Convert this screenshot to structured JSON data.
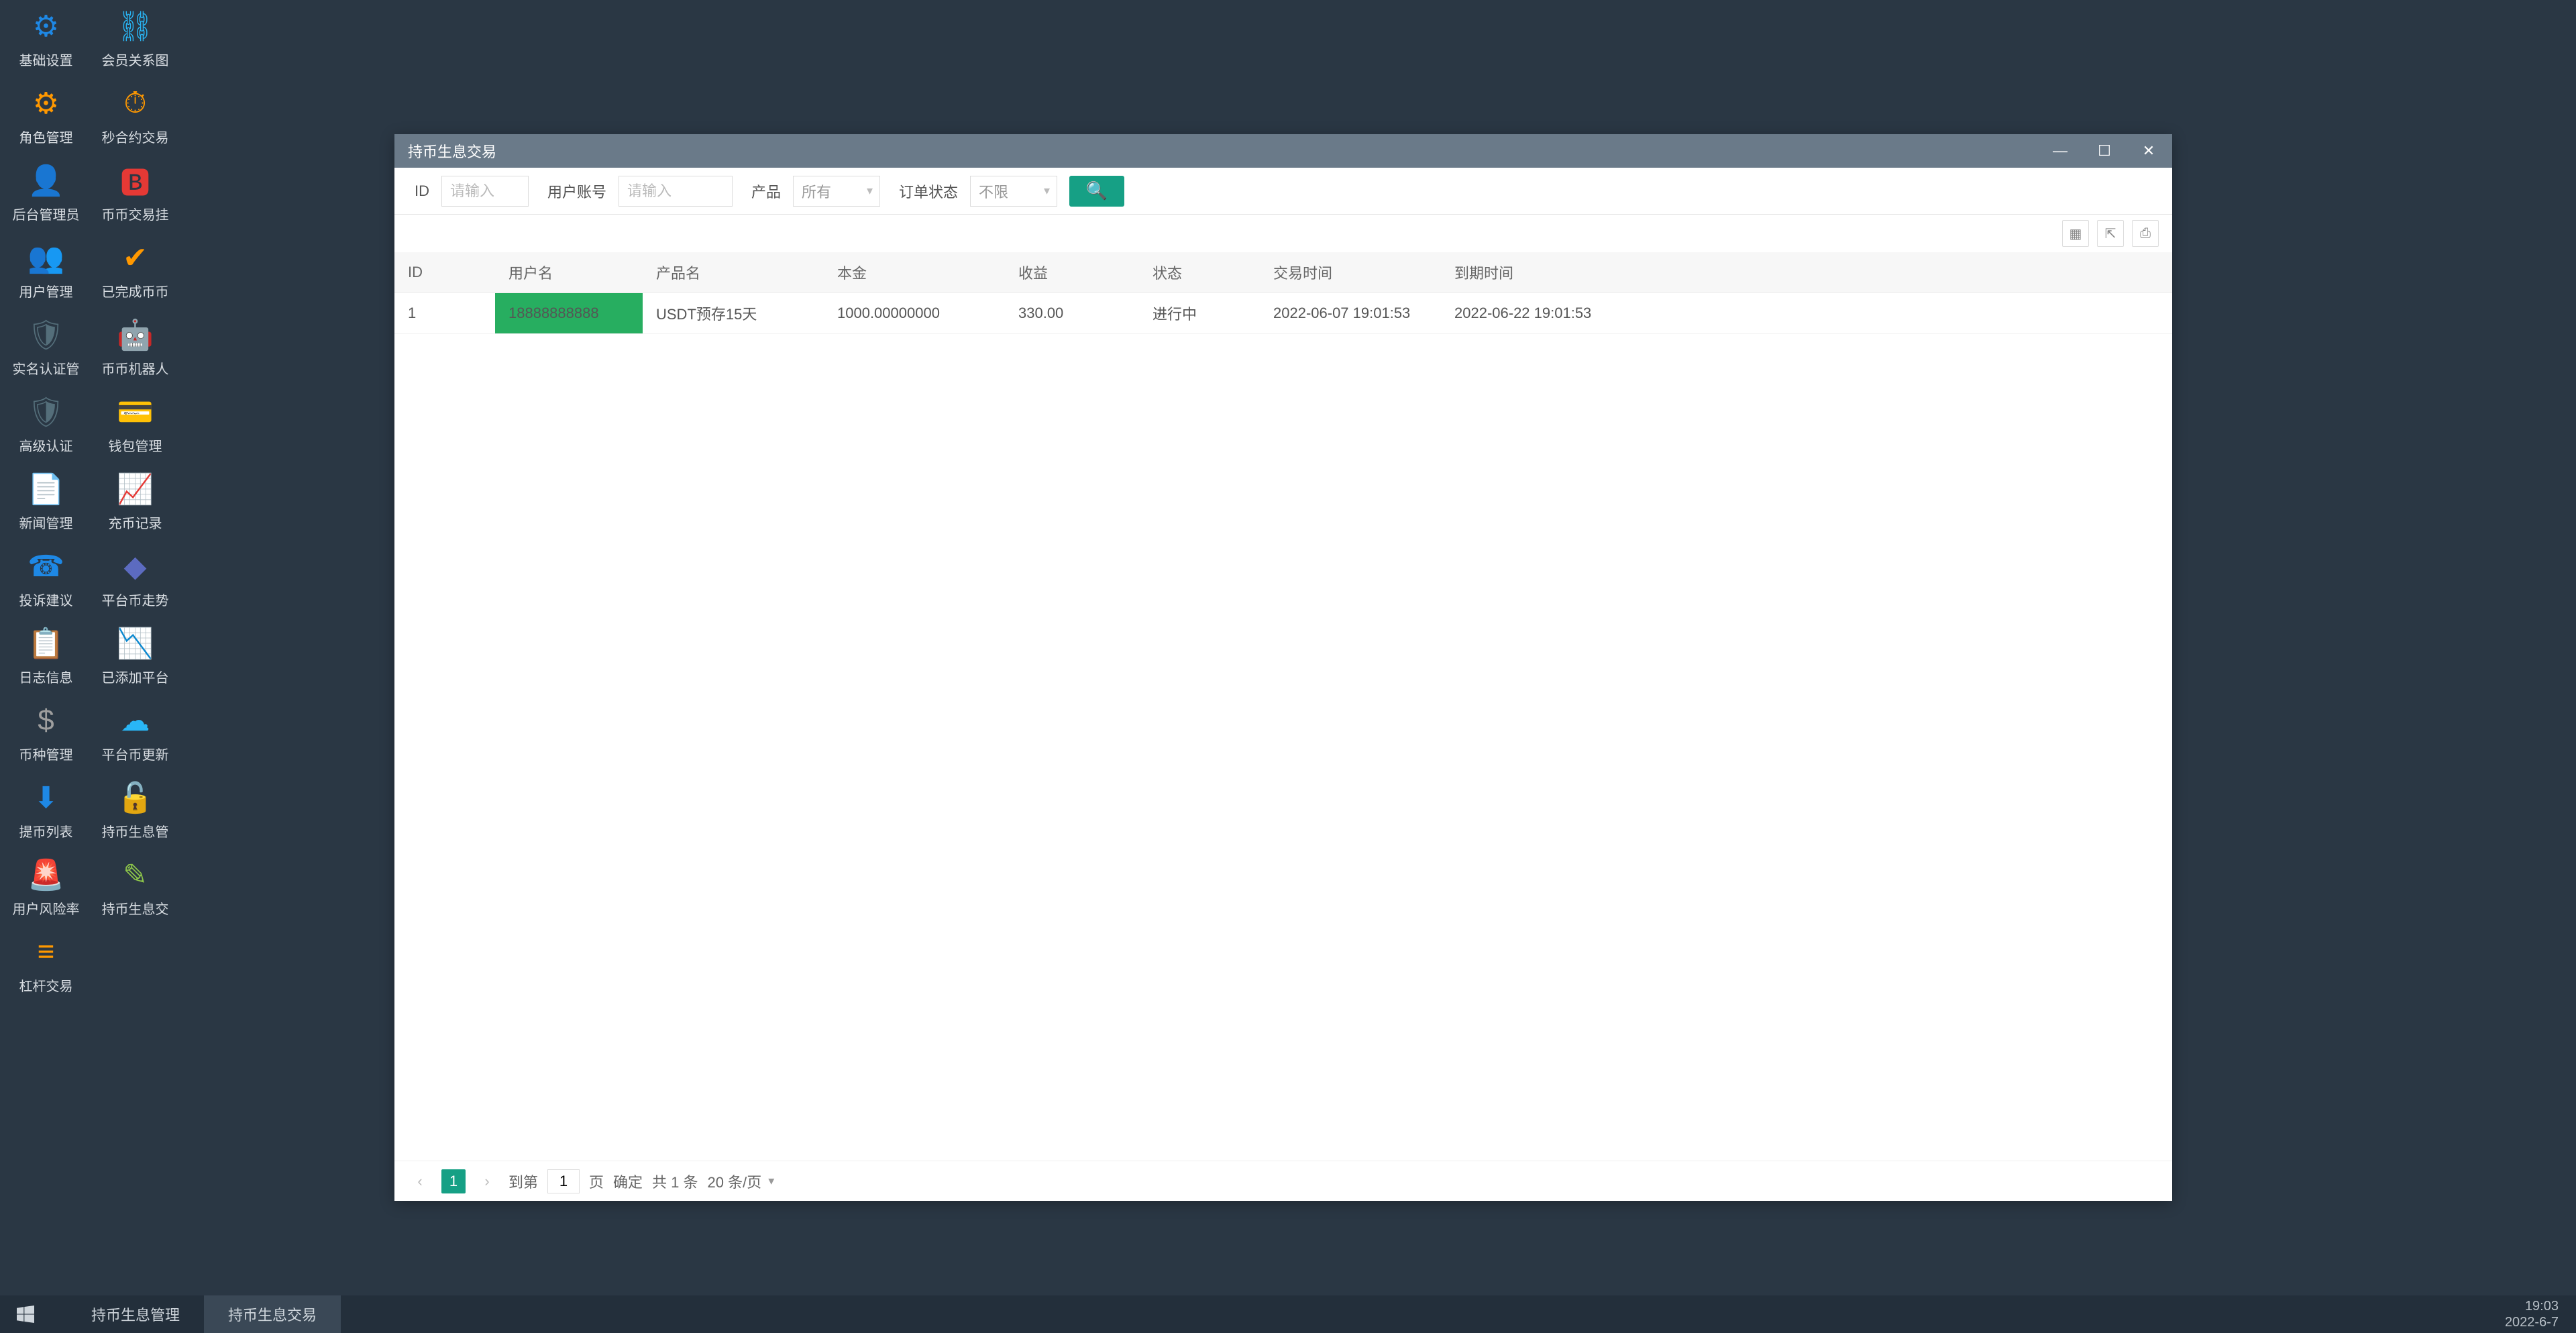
{
  "sidebar": [
    {
      "label": "基础设置",
      "icon": "⚙",
      "color": "#1e88e5"
    },
    {
      "label": "会员关系图",
      "icon": "⛓",
      "color": "#29b6f6"
    },
    {
      "label": "角色管理",
      "icon": "⚙",
      "color": "#ff9800"
    },
    {
      "label": "秒合约交易",
      "icon": "⏱",
      "color": "#ff9800"
    },
    {
      "label": "后台管理员",
      "icon": "👤",
      "color": "#1e88e5"
    },
    {
      "label": "币币交易挂",
      "icon": "🅱",
      "color": "#e53935"
    },
    {
      "label": "用户管理",
      "icon": "👥",
      "color": "#ffb300"
    },
    {
      "label": "已完成币币",
      "icon": "✔",
      "color": "#ff9800"
    },
    {
      "label": "实名认证管",
      "icon": "🛡",
      "color": "#546e7a"
    },
    {
      "label": "币币机器人",
      "icon": "🤖",
      "color": "#26a69a"
    },
    {
      "label": "高级认证",
      "icon": "🛡",
      "color": "#546e7a"
    },
    {
      "label": "钱包管理",
      "icon": "💳",
      "color": "#29b6f6"
    },
    {
      "label": "新闻管理",
      "icon": "📄",
      "color": "#26a69a"
    },
    {
      "label": "充币记录",
      "icon": "📈",
      "color": "#e53935"
    },
    {
      "label": "投诉建议",
      "icon": "☎",
      "color": "#1e88e5"
    },
    {
      "label": "平台币走势",
      "icon": "◆",
      "color": "#5c6bc0"
    },
    {
      "label": "日志信息",
      "icon": "📋",
      "color": "#26a69a"
    },
    {
      "label": "已添加平台",
      "icon": "📉",
      "color": "#e53935"
    },
    {
      "label": "币种管理",
      "icon": "$",
      "color": "#9e9e9e"
    },
    {
      "label": "平台币更新",
      "icon": "☁",
      "color": "#29b6f6"
    },
    {
      "label": "提币列表",
      "icon": "⬇",
      "color": "#1e88e5"
    },
    {
      "label": "持币生息管",
      "icon": "🔓",
      "color": "#8bc34a"
    },
    {
      "label": "用户风险率",
      "icon": "🚨",
      "color": "#e53935"
    },
    {
      "label": "持币生息交",
      "icon": "✎",
      "color": "#8bc34a"
    },
    {
      "label": "杠杆交易",
      "icon": "≡",
      "color": "#ff9800"
    }
  ],
  "window": {
    "title": "持币生息交易",
    "filters": {
      "id_label": "ID",
      "id_placeholder": "请输入",
      "account_label": "用户账号",
      "account_placeholder": "请输入",
      "product_label": "产品",
      "product_value": "所有",
      "order_status_label": "订单状态",
      "order_status_value": "不限"
    },
    "columns": [
      "ID",
      "用户名",
      "产品名",
      "本金",
      "收益",
      "状态",
      "交易时间",
      "到期时间"
    ],
    "rows": [
      {
        "id": "1",
        "user": "18888888888",
        "product": "USDT预存15天",
        "principal": "1000.00000000",
        "profit": "330.00",
        "status": "进行中",
        "trade_time": "2022-06-07 19:01:53",
        "expire_time": "2022-06-22 19:01:53"
      }
    ],
    "pagination": {
      "current": "1",
      "goto_label": "到第",
      "goto_value": "1",
      "page_label": "页",
      "confirm": "确定",
      "total": "共 1 条",
      "page_size": "20 条/页"
    }
  },
  "taskbar": {
    "items": [
      {
        "label": "持币生息管理",
        "active": false
      },
      {
        "label": "持币生息交易",
        "active": true
      }
    ],
    "time": "19:03",
    "date": "2022-6-7"
  }
}
